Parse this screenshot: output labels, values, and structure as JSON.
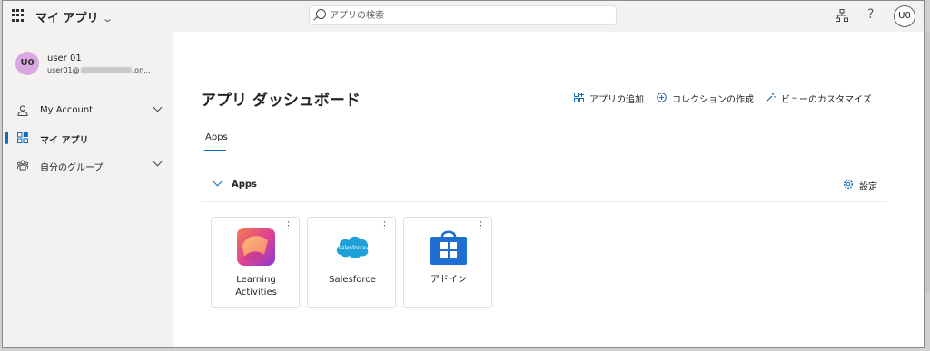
{
  "header": {
    "app_title": "マイ アプリ",
    "search_placeholder": "アプリの検索",
    "user_initials": "U0"
  },
  "sidebar": {
    "user": {
      "initials": "U0",
      "name": "user 01",
      "email_prefix": "user01@",
      "email_suffix": ".on..."
    },
    "items": [
      {
        "label": "My Account",
        "has_chevron": true,
        "active": false,
        "icon": "person-icon"
      },
      {
        "label": "マイ アプリ",
        "has_chevron": false,
        "active": true,
        "icon": "apps-icon"
      },
      {
        "label": "自分のグループ",
        "has_chevron": true,
        "active": false,
        "icon": "groups-icon"
      }
    ]
  },
  "main": {
    "title": "アプリ ダッシュボード",
    "actions": {
      "add_app": "アプリの追加",
      "create_collection": "コレクションの作成",
      "customize_view": "ビューのカスタマイズ"
    },
    "tab": "Apps",
    "section": {
      "title": "Apps",
      "settings_label": "設定"
    },
    "apps": [
      {
        "name": "Learning Activities",
        "icon": "learning-activities-icon"
      },
      {
        "name": "Salesforce",
        "icon": "salesforce-icon",
        "logo_text": "salesforce"
      },
      {
        "name": "アドイン",
        "icon": "store-bag-icon"
      }
    ]
  },
  "colors": {
    "accent": "#0f6cbd",
    "avatar_bg": "#d7a9e0",
    "salesforce": "#1ea0d9"
  }
}
